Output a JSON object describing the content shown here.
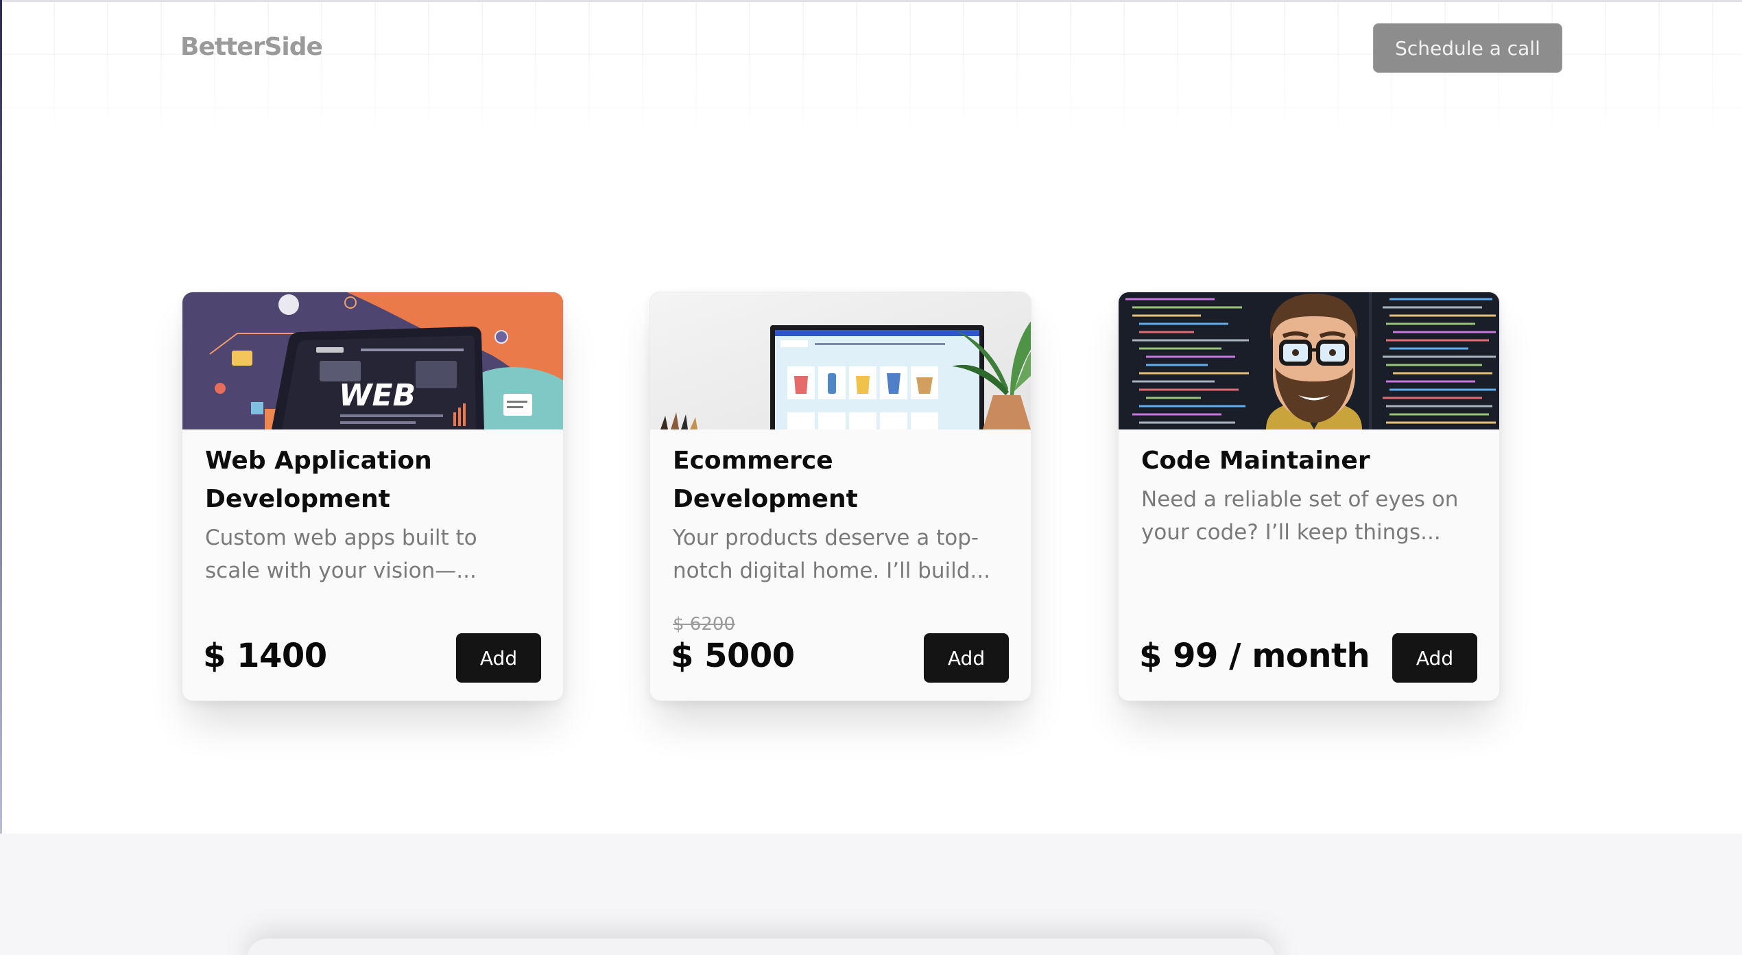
{
  "header": {
    "logo": "BetterSide",
    "cta_label": "Schedule a call"
  },
  "cards": [
    {
      "title": "Web Application Development",
      "description": "Custom web apps built to scale with your vision—...",
      "price": "$ 1400",
      "old_price": "",
      "add_label": "Add",
      "image_text": "WEB",
      "image_icon": "web-development-illustration"
    },
    {
      "title": "Ecommerce Development",
      "description": "Your products deserve a top-notch digital home. I’ll build...",
      "price": "$ 5000",
      "old_price": "$ 6200",
      "add_label": "Add",
      "image_icon": "ecommerce-monitor-illustration"
    },
    {
      "title": "Code Maintainer",
      "description": "Need a reliable set of eyes on your code? I’ll keep things...",
      "price": "$ 99 / month",
      "old_price": "",
      "add_label": "Add",
      "image_icon": "developer-avatar-code-illustration"
    }
  ],
  "colors": {
    "button_dark": "#141414",
    "cta_gray": "#8d8d8d",
    "card_bg": "#fafafa",
    "text_muted": "#7a7a7a"
  }
}
